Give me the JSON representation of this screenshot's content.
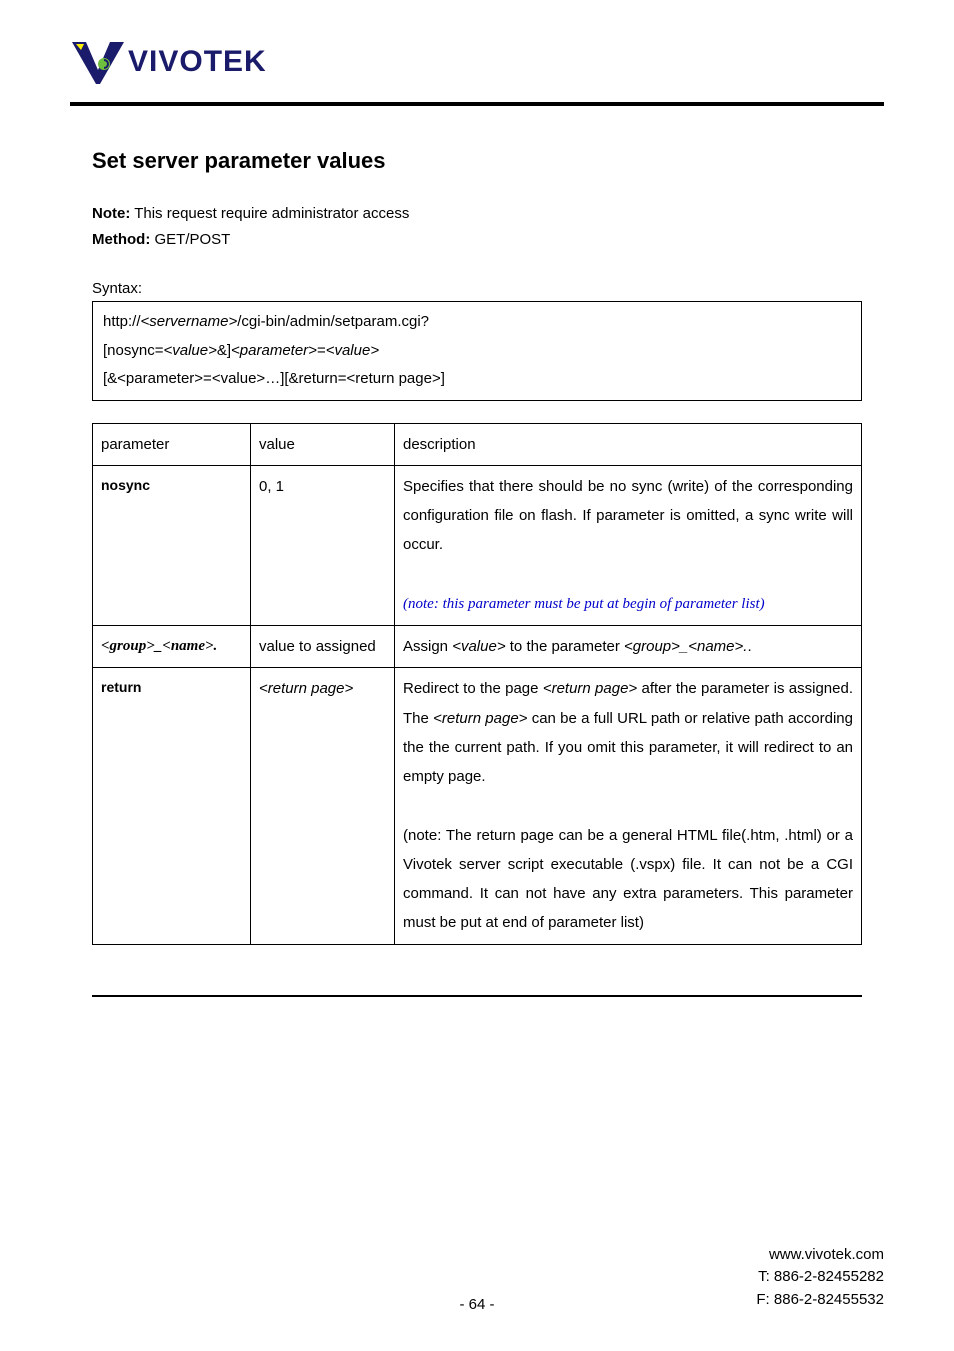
{
  "logo_text": "VIVOTEK",
  "title": "Set server parameter values",
  "note_label": "Note:",
  "note_text": " This request require administrator access",
  "method_label": "Method:",
  "method_text": " GET/POST",
  "syntax_label": "Syntax:",
  "syntax": {
    "line1a": "http://",
    "line1b": "<servername>",
    "line1c": "/cgi-bin/admin/setparam.cgi?",
    "line2a": "[nosync=",
    "line2b": "<value>",
    "line2c": "&]",
    "line2d": "<parameter>",
    "line2e": "=",
    "line2f": "<value>",
    "line3": "[&<parameter>=<value>…][&return=<return page>]"
  },
  "headers": {
    "c1": "parameter",
    "c2": "value",
    "c3": "description"
  },
  "rows": {
    "r1": {
      "param": "nosync",
      "value": "0, 1",
      "desc_p1": "Specifies that there should be no sync (write) of the corresponding configuration file on flash. If parameter is omitted, a sync write will occur.",
      "desc_note": "(note: this parameter must be put at begin of parameter list)"
    },
    "r2": {
      "param": "<group>_<name>.",
      "value": "value to assigned",
      "desc_a": "Assign ",
      "desc_val": "<value>",
      "desc_b": " to the parameter ",
      "desc_gn": "<group>_<name>.",
      "desc_c": "."
    },
    "r3": {
      "param": "return",
      "value": "<return page>",
      "desc_a": "Redirect to the page ",
      "desc_rp1": "<return page>",
      "desc_b": " after the parameter is assigned. The ",
      "desc_rp2": "<return page>",
      "desc_c": " can be a full URL path or relative path according the the current path. If you omit this parameter, it will redirect to an empty page.",
      "desc_note": "(note: The return page can be a general HTML file(.htm, .html) or a Vivotek server script executable (.vspx) file. It can not be a CGI command. It can not have any extra parameters. This parameter must be put at end of parameter list)"
    }
  },
  "footer": {
    "pagenum": "- 64 -",
    "site": "www.vivotek.com",
    "tel": "T: 886-2-82455282",
    "fax": "F: 886-2-82455532"
  }
}
